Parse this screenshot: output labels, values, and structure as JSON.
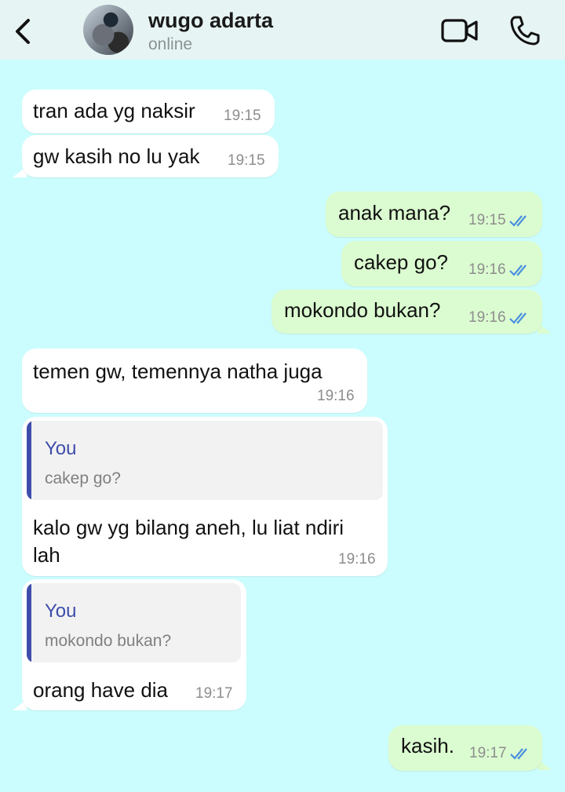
{
  "header": {
    "contact_name": "wugo adarta",
    "status": "online",
    "icons": [
      "chevron-left-icon",
      "avatar",
      "video-camera-icon",
      "phone-icon"
    ]
  },
  "colors": {
    "chat_background": "#ccfdfe",
    "header_background": "#e6f4f3",
    "incoming_bubble": "#ffffff",
    "outgoing_bubble": "#dbfcd0",
    "read_ticks": "#4a8fe0",
    "quote_accent": "#3e4dab"
  },
  "messages": [
    {
      "direction": "in",
      "text": "tran ada yg naksir",
      "time": "19:15"
    },
    {
      "direction": "in",
      "text": "gw kasih no lu yak",
      "time": "19:15"
    },
    {
      "direction": "out",
      "text": "anak mana?",
      "time": "19:15",
      "status": "read"
    },
    {
      "direction": "out",
      "text": "cakep go?",
      "time": "19:16",
      "status": "read"
    },
    {
      "direction": "out",
      "text": "mokondo bukan?",
      "time": "19:16",
      "status": "read"
    },
    {
      "direction": "in",
      "text": "temen gw, temennya natha juga",
      "time": "19:16"
    },
    {
      "direction": "in",
      "quote": {
        "author": "You",
        "text": "cakep go?"
      },
      "text_line1": "kalo gw yg bilang aneh, lu liat ndiri",
      "text_line2": "lah",
      "time": "19:16"
    },
    {
      "direction": "in",
      "quote": {
        "author": "You",
        "text": "mokondo bukan?"
      },
      "text": "orang have dia",
      "time": "19:17"
    },
    {
      "direction": "out",
      "text": "kasih.",
      "time": "19:17",
      "status": "read"
    }
  ]
}
